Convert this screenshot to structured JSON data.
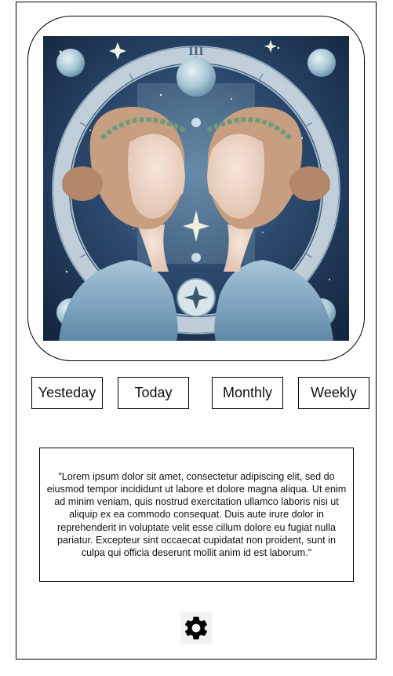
{
  "artwork": {
    "roman_numeral": "III"
  },
  "tabs": [
    {
      "label": "Yesteday"
    },
    {
      "label": "Today"
    },
    {
      "label": "Monthly"
    },
    {
      "label": "Weekly"
    }
  ],
  "horoscope": {
    "text": "\"Lorem ipsum dolor sit amet, consectetur adipiscing elit, sed do eiusmod tempor incididunt ut labore et dolore magna aliqua. Ut enim ad minim veniam, quis nostrud exercitation ullamco laboris nisi ut aliquip ex ea commodo consequat. Duis aute irure dolor in reprehenderit in voluptate velit esse cillum dolore eu fugiat nulla pariatur. Excepteur sint occaecat cupidatat non proident, sunt in culpa qui officia deserunt mollit anim id est laborum.\""
  },
  "settings": {
    "icon": "gear-icon"
  }
}
